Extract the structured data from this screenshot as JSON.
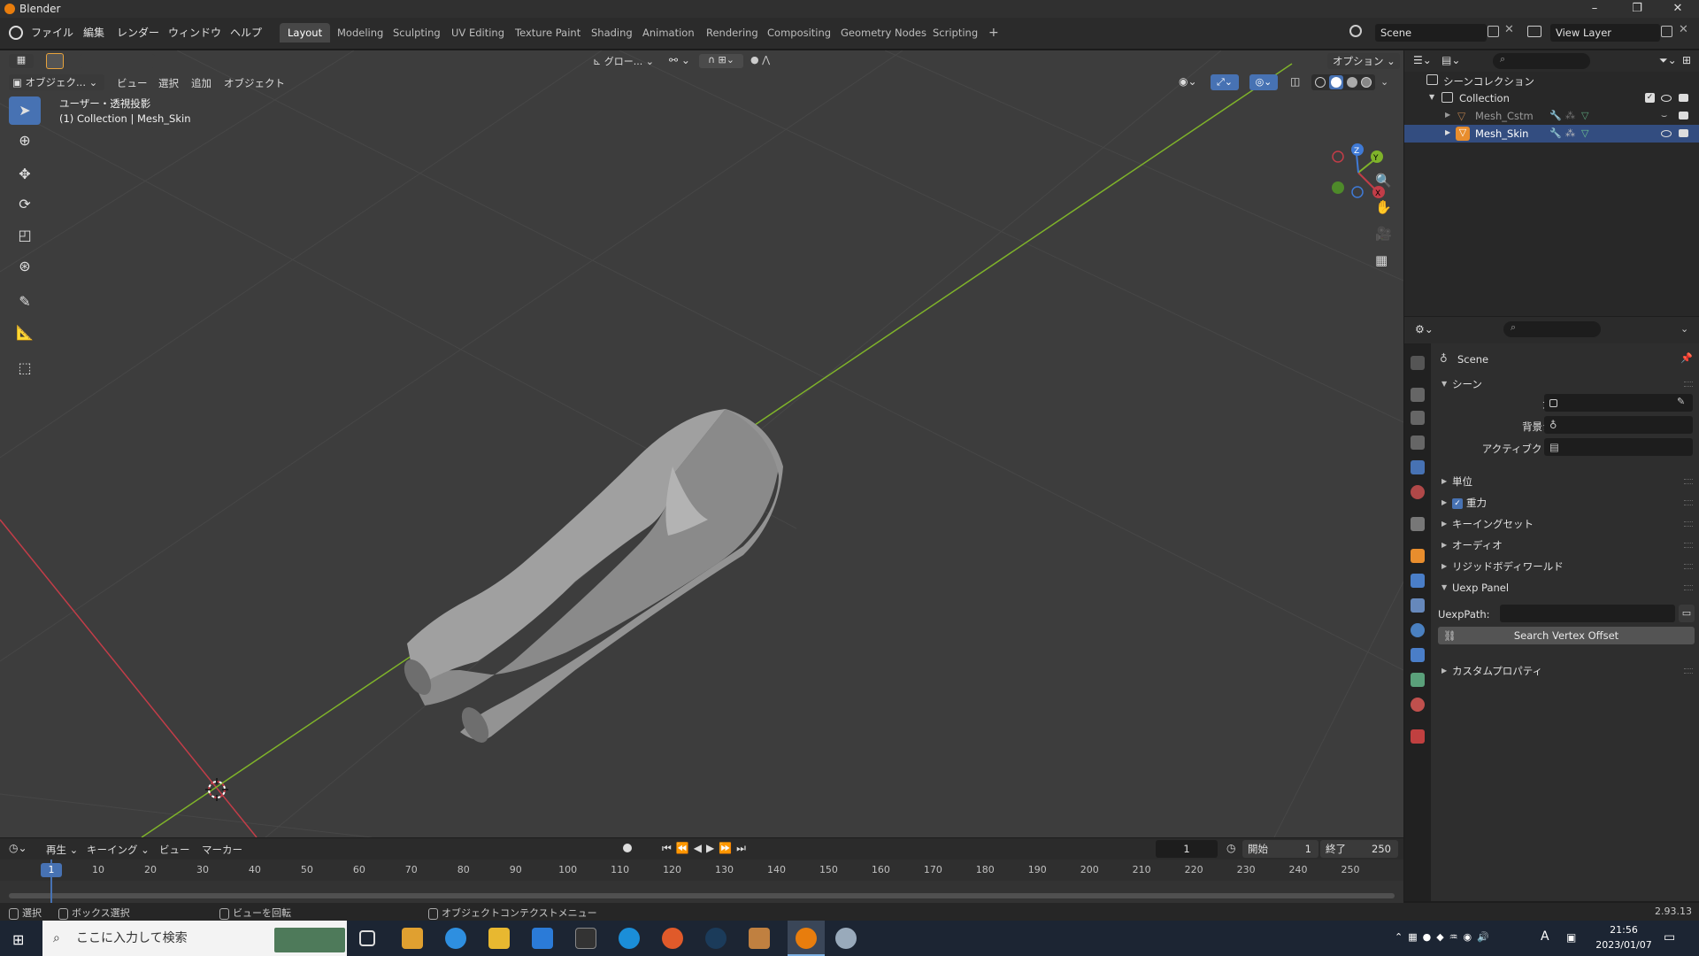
{
  "window": {
    "title": "Blender",
    "controls": [
      "–",
      "❐",
      "✕"
    ]
  },
  "menu": [
    "ファイル",
    "編集",
    "レンダー",
    "ウィンドウ",
    "ヘルプ"
  ],
  "workspaces": [
    "Layout",
    "Modeling",
    "Sculpting",
    "UV Editing",
    "Texture Paint",
    "Shading",
    "Animation",
    "Rendering",
    "Compositing",
    "Geometry Nodes",
    "Scripting"
  ],
  "workspace_add": "+",
  "scene": {
    "name": "Scene",
    "view_layer": "View Layer"
  },
  "viewport": {
    "mode": "オブジェク...",
    "menus": [
      "ビュー",
      "選択",
      "追加",
      "オブジェクト"
    ],
    "transform_orientation": "グロー...",
    "options": "オプション",
    "view_name": "ユーザー・透視投影",
    "collection_info": "(1) Collection | Mesh_Skin",
    "gizmo": {
      "x": "X",
      "y": "Y",
      "z": "Z"
    }
  },
  "outliner": {
    "root": "シーンコレクション",
    "collection": "Collection",
    "objects": [
      {
        "name": "Mesh_Cstm",
        "selected": false
      },
      {
        "name": "Mesh_Skin",
        "selected": true
      }
    ]
  },
  "properties": {
    "context_name": "Scene",
    "panels": {
      "scene": {
        "title": "シーン",
        "camera_label": "カメラ",
        "bg_scene_label": "背景シーン",
        "active_clip_label": "アクティブクリップ"
      },
      "collapsed": [
        "単位",
        "重力",
        "キーイングセット",
        "オーディオ",
        "リジッドボディワールド"
      ],
      "gravity_checked": true,
      "uexp": {
        "title": "Uexp Panel",
        "path_label": "UexpPath:",
        "path_value": "",
        "button": "Search Vertex Offset"
      },
      "custom": "カスタムプロパティ"
    }
  },
  "timeline": {
    "menus": [
      "再生",
      "キーイング",
      "ビュー",
      "マーカー"
    ],
    "current_frame": "1",
    "start_label": "開始",
    "start": "1",
    "end_label": "終了",
    "end": "250",
    "ruler": [
      "1",
      "10",
      "20",
      "30",
      "40",
      "50",
      "60",
      "70",
      "80",
      "90",
      "100",
      "110",
      "120",
      "130",
      "140",
      "150",
      "160",
      "170",
      "180",
      "190",
      "200",
      "210",
      "220",
      "230",
      "240",
      "250"
    ]
  },
  "status": {
    "select": "選択",
    "box_select": "ボックス選択",
    "rotate_view": "ビューを回転",
    "context_menu": "オブジェクトコンテクストメニュー",
    "version": "2.93.13"
  },
  "taskbar": {
    "search_placeholder": "ここに入力して検索",
    "time": "21:56",
    "date": "2023/01/07",
    "ime": "A"
  },
  "colors": {
    "accent": "#4772b3",
    "x_axis": "#c23d48",
    "y_axis": "#7fb32a",
    "orange": "#e87d0d"
  }
}
